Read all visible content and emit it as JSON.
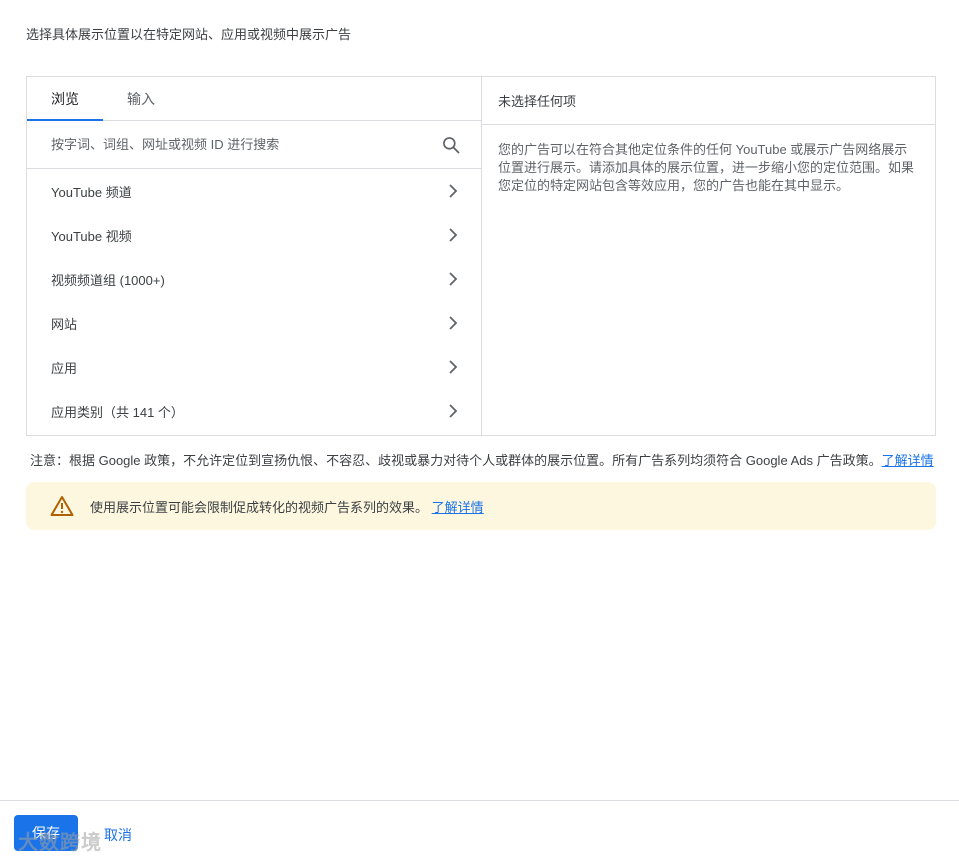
{
  "intro": "选择具体展示位置以在特定网站、应用或视频中展示广告",
  "tabs": [
    {
      "label": "浏览",
      "active": true
    },
    {
      "label": "输入",
      "active": false
    }
  ],
  "search": {
    "placeholder": "按字词、词组、网址或视频 ID 进行搜索",
    "icon": "search-icon"
  },
  "categories": [
    {
      "label": "YouTube 频道"
    },
    {
      "label": "YouTube 视频"
    },
    {
      "label": "视频频道组 (1000+)"
    },
    {
      "label": "网站"
    },
    {
      "label": "应用"
    },
    {
      "label": "应用类别（共 141 个）"
    }
  ],
  "selection": {
    "header": "未选择任何项",
    "body": "您的广告可以在符合其他定位条件的任何 YouTube 或展示广告网络展示位置进行展示。请添加具体的展示位置，进一步缩小您的定位范围。如果您定位的特定网站包含等效应用，您的广告也能在其中显示。"
  },
  "note": {
    "text": "注意：根据 Google 政策，不允许定位到宣扬仇恨、不容忍、歧视或暴力对待个人或群体的展示位置。所有广告系列均须符合 Google Ads 广告政策。",
    "link": "了解详情"
  },
  "warning": {
    "text": "使用展示位置可能会限制促成转化的视频广告系列的效果。",
    "link": "了解详情",
    "icon": "warning-icon",
    "color": "#fef7e0"
  },
  "footer": {
    "save": "保存",
    "cancel": "取消"
  },
  "watermark": "大数跨境",
  "colors": {
    "accent": "#1a73e8",
    "warning_icon": "#b06000",
    "border": "#dadce0"
  }
}
